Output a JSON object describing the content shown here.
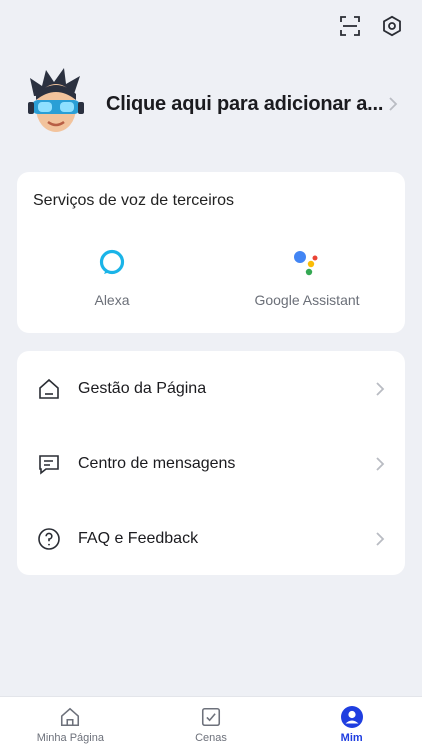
{
  "header": {
    "scan_icon": "scan-icon",
    "settings_icon": "settings-icon"
  },
  "profile": {
    "prompt": "Clique aqui para adicionar a..."
  },
  "voice_services": {
    "title": "Serviços de voz de terceiros",
    "items": [
      {
        "label": "Alexa",
        "icon": "alexa-icon",
        "color": "#1ab4e8"
      },
      {
        "label": "Google Assistant",
        "icon": "google-assistant-icon"
      }
    ]
  },
  "menu": {
    "items": [
      {
        "label": "Gestão da Página",
        "icon": "home-icon"
      },
      {
        "label": "Centro de mensagens",
        "icon": "message-icon"
      },
      {
        "label": "FAQ e Feedback",
        "icon": "help-icon"
      }
    ]
  },
  "tabbar": {
    "active_color": "#1f3ee0",
    "tabs": [
      {
        "label": "Minha Página",
        "icon": "home-icon"
      },
      {
        "label": "Cenas",
        "icon": "scenes-icon"
      },
      {
        "label": "Mim",
        "icon": "user-icon",
        "active": true
      }
    ]
  }
}
